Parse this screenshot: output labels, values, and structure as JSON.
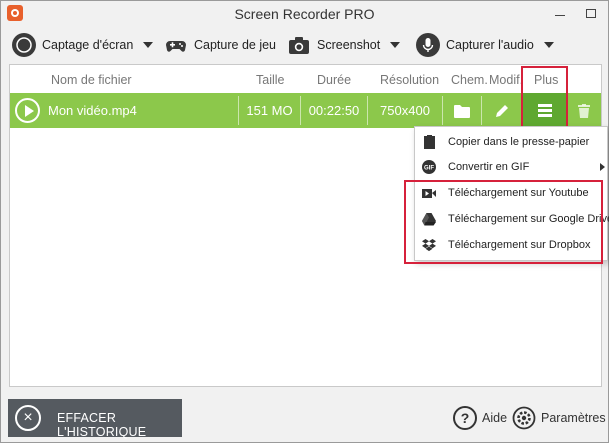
{
  "window": {
    "title": "Screen Recorder PRO",
    "accent": "#8cc84b",
    "highlight_color": "#d6213b"
  },
  "toolbar": {
    "items": [
      {
        "label": "Captage d'écran",
        "icon": "record-icon"
      },
      {
        "label": "Capture de jeu",
        "icon": "gamepad-icon"
      },
      {
        "label": "Screenshot",
        "icon": "camera-icon"
      },
      {
        "label": "Capturer l'audio",
        "icon": "microphone-icon"
      }
    ]
  },
  "table": {
    "headers": {
      "name": "Nom de fichier",
      "size": "Taille",
      "duration": "Durée",
      "resolution": "Résolution",
      "path": "Chem.",
      "edit": "Modif.",
      "more": "Plus"
    },
    "rows": [
      {
        "name": "Mon vidéo.mp4",
        "size": "151 MO",
        "duration": "00:22:50",
        "resolution": "750x400"
      }
    ]
  },
  "context_menu": {
    "items": [
      {
        "label": "Copier dans le presse-papier",
        "icon": "clipboard-icon"
      },
      {
        "label": "Convertir en GIF",
        "icon": "gif-icon",
        "submenu": true
      },
      {
        "label": "Téléchargement sur Youtube",
        "icon": "youtube-icon"
      },
      {
        "label": "Téléchargement sur Google Drive",
        "icon": "google-drive-icon"
      },
      {
        "label": "Téléchargement sur Dropbox",
        "icon": "dropbox-icon"
      }
    ]
  },
  "bottom": {
    "clear_label": "EFFACER L'HISTORIQUE",
    "help_label": "Aide",
    "settings_label": "Paramètres"
  }
}
